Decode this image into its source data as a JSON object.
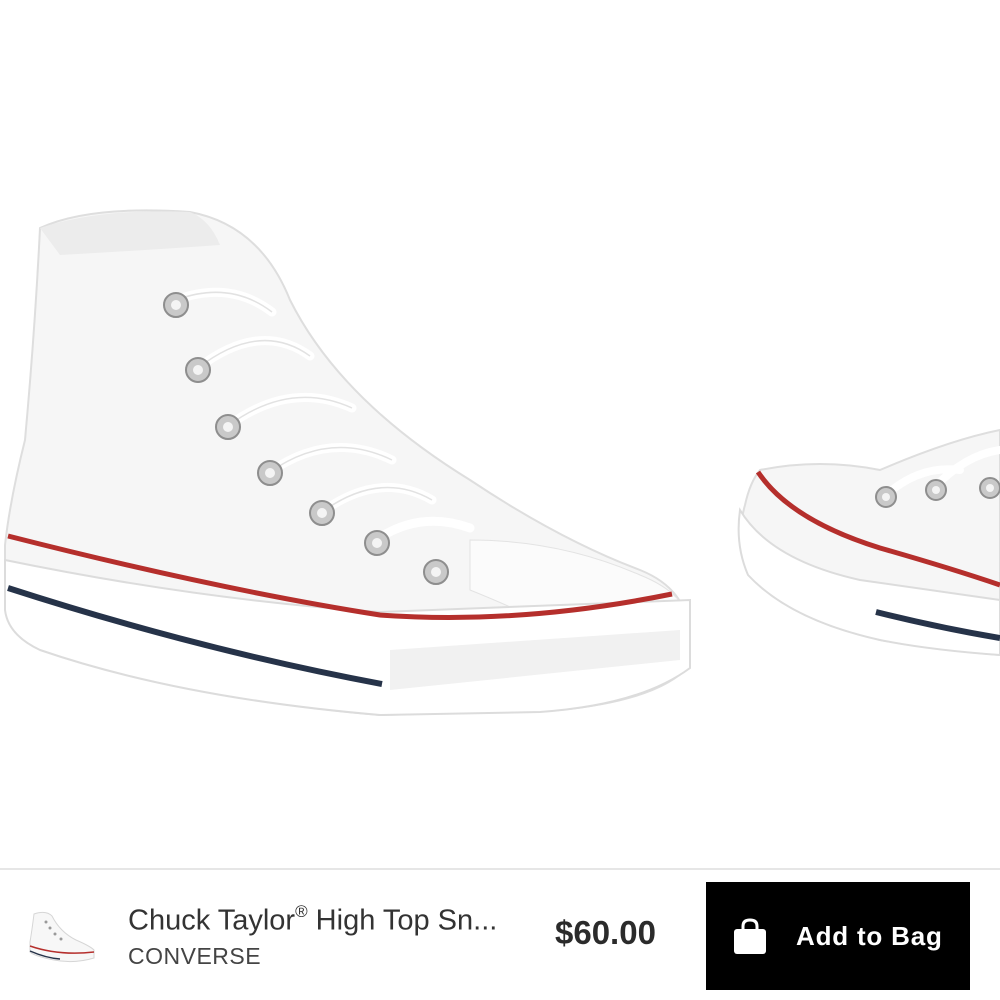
{
  "gallery": {
    "images": [
      {
        "subject": "white high-top sneaker"
      },
      {
        "subject": "white low-top sneaker"
      }
    ]
  },
  "product_bar": {
    "title": "Chuck Taylor",
    "title_mark": "®",
    "title_rest": " High Top Sn...",
    "brand": "CONVERSE",
    "price": "$60.00",
    "add_to_bag_label": "Add to Bag",
    "icons": [
      "shopping-bag-icon"
    ]
  },
  "colors": {
    "button_bg": "#000000",
    "button_text": "#ffffff",
    "stripe_red": "#b52f2c",
    "stripe_navy": "#263349"
  }
}
